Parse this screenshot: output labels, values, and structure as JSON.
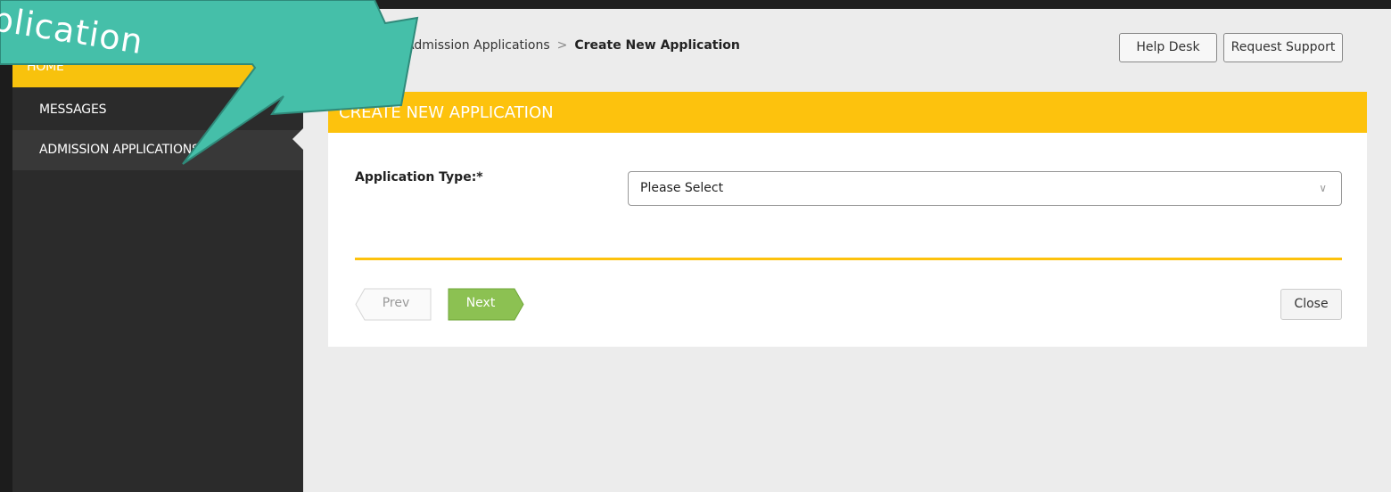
{
  "sidebar": {
    "items": [
      {
        "label": "HOME"
      },
      {
        "label": "MESSAGES"
      },
      {
        "label": "ADMISSION APPLICATIONS"
      }
    ]
  },
  "breadcrumb": {
    "parent": "Admission Applications",
    "separator": ">",
    "current": "Create New Application"
  },
  "header_buttons": {
    "help": "Help Desk",
    "support": "Request Support"
  },
  "panel": {
    "title": "CREATE NEW APPLICATION",
    "field_label": "Application Type:*",
    "select_value": "Please Select",
    "prev_label": "Prev",
    "next_label": "Next",
    "close_label": "Close"
  },
  "callout": {
    "text": "pplication"
  },
  "colors": {
    "accent": "#fdc20d",
    "sidebar_bg": "#2b2b2b",
    "next_green": "#8cc152",
    "callout_teal": "#45bfa9"
  },
  "icons": {
    "select_chevron": "chevron-down-icon"
  }
}
